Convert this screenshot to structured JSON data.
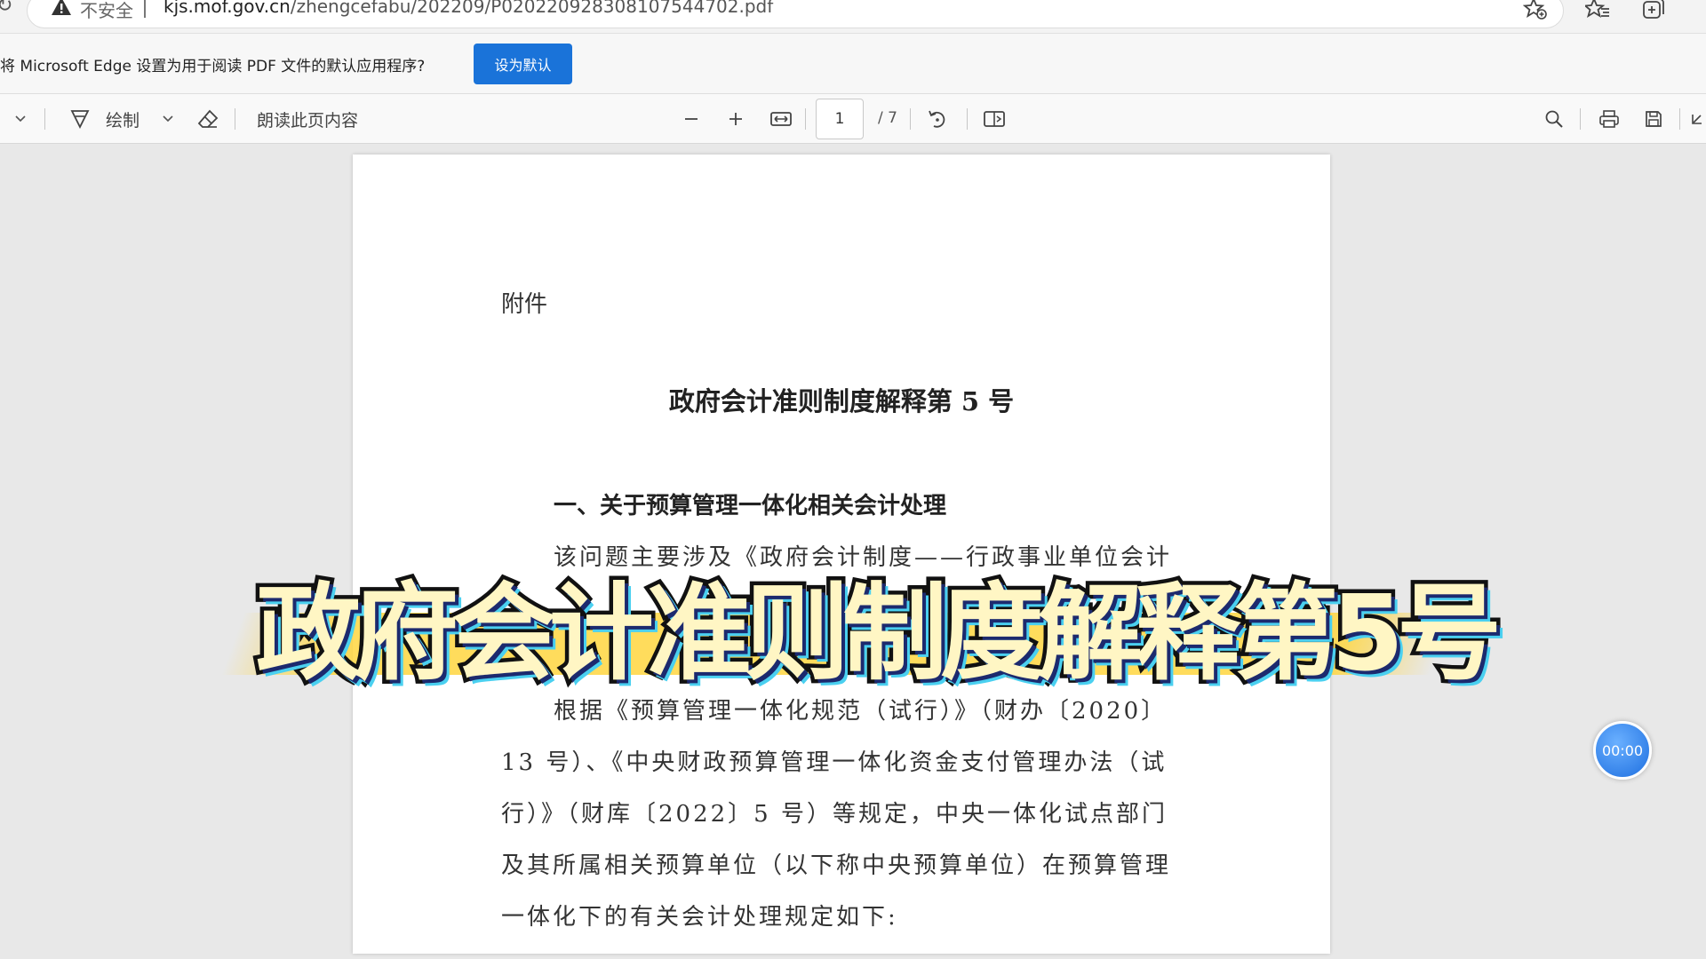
{
  "address_bar": {
    "security_label": "不安全",
    "url_host": "kjs.mof.gov.cn",
    "url_path": "/zhengcefabu/202209/P020220928308107544702.pdf"
  },
  "infobar": {
    "message": "将 Microsoft Edge 设置为用于阅读 PDF 文件的默认应用程序?",
    "button_label": "设为默认"
  },
  "pdf_toolbar": {
    "draw_label": "绘制",
    "read_aloud_label": "朗读此页内容",
    "page_current": "1",
    "page_total": "/ 7"
  },
  "document": {
    "attachment_label": "附件",
    "title": "政府会计准则制度解释第 5 号",
    "section_heading": "一、关于预算管理一体化相关会计处理",
    "lines": [
      "该问题主要涉及《政府会计制度——行政事业单位会计",
      "根据《预算管理一体化规范（试行）》（财办〔2020〕",
      "13 号）、《中央财政预算管理一体化资金支付管理办法（试",
      "行）》（财库〔2022〕5 号）等规定，中央一体化试点部门",
      "及其所属相关预算单位（以下称中央预算单位）在预算管理",
      "一体化下的有关会计处理规定如下:"
    ]
  },
  "overlay": {
    "caption": "政府会计准则制度解释第5号",
    "timer": "00:00"
  },
  "colors": {
    "accent_blue": "#1a73d9",
    "caption_yellow": "#ffd640",
    "timer_blue": "#1e6fe0"
  }
}
